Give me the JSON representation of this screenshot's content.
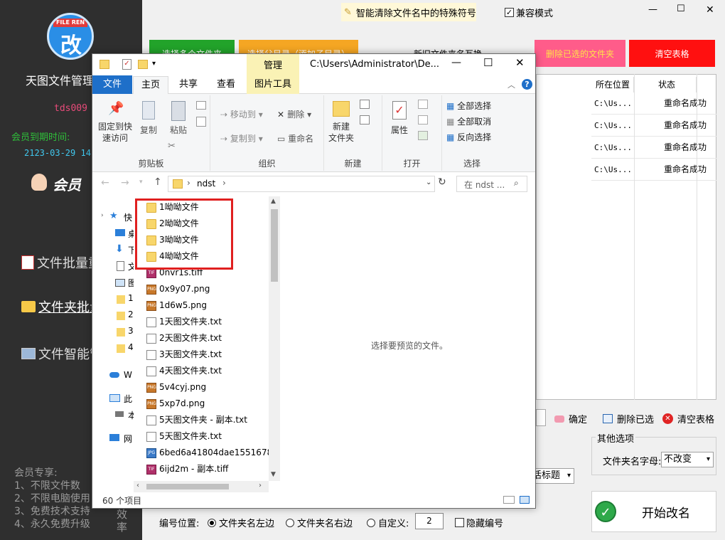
{
  "app": {
    "logo_text": "FILE REN",
    "logo_glyph": "改",
    "title": "天图文件管理",
    "user": "tds009",
    "expiry_label": "会员到期时间:",
    "expiry_date": "2123-03-29 14:",
    "vip_label": "会员",
    "menu": [
      {
        "label": "文件批量重"
      },
      {
        "label": "文件夹批量"
      },
      {
        "label": "文件智能管"
      }
    ],
    "vip_perks_title": "会员专享:",
    "vip_perks": [
      "1、不限文件数",
      "2、不限电脑使用",
      "3、免费技术支持",
      "4、永久免费升级"
    ],
    "efficiency": "效率"
  },
  "topbar": {
    "special_chars_label": "智能清除文件名中的特殊符号",
    "compat_label": "兼容模式",
    "compat_checked": true,
    "window_controls": [
      "—",
      "☐",
      "✕"
    ]
  },
  "buttons": {
    "select_folders": "选择多个文件夹",
    "select_parent": "选择父目录（添加子目录）",
    "swap": "新旧文件夹名互换",
    "delete_selected_folders": "删除已选的文件夹",
    "clear_table": "清空表格",
    "confirm": "确定",
    "delete_selected": "删除已选",
    "clear_table2": "清空表格",
    "start_rename": "开始改名"
  },
  "table": {
    "headers": [
      "所在位置",
      "状态"
    ],
    "rows": [
      {
        "location": "C:\\Us...",
        "status": "重命名成功"
      },
      {
        "location": "C:\\Us...",
        "status": "重命名成功"
      },
      {
        "location": "C:\\Us...",
        "status": "重命名成功"
      },
      {
        "location": "C:\\Us...",
        "status": "重命名成功"
      }
    ]
  },
  "other_options": {
    "title": "其他选项",
    "case_label": "文件夹名字母:",
    "case_value": "不改变",
    "partial_label": "活标题"
  },
  "numbering": {
    "label": "编号位置:",
    "opt_left": "文件夹名左边",
    "opt_right": "文件夹名右边",
    "opt_custom": "自定义:",
    "custom_value": "2",
    "hide_label": "隐藏编号",
    "selected": "left"
  },
  "explorer": {
    "qat_title": "",
    "manage_tab": "管理",
    "path_title": "C:\\Users\\Administrator\\De...",
    "tabs": [
      "文件",
      "主页",
      "共享",
      "查看",
      "图片工具"
    ],
    "active_tab": "主页",
    "ribbon": {
      "pin": "固定到快\n速访问",
      "copy": "复制",
      "paste": "粘贴",
      "clipboard": "剪贴板",
      "move_to": "移动到",
      "copy_to": "复制到",
      "delete": "删除",
      "rename": "重命名",
      "organize": "组织",
      "new_folder": "新建\n文件夹",
      "new": "新建",
      "properties": "属性",
      "open": "打开",
      "select_all": "全部选择",
      "select_none": "全部取消",
      "invert": "反向选择",
      "select": "选择"
    },
    "address": "ndst",
    "search_placeholder": "在 ndst ...",
    "nav_items": [
      "快",
      "桌",
      "下",
      "文",
      "图",
      "1",
      "2",
      "3",
      "4",
      "W",
      "此",
      "本",
      "网"
    ],
    "files": [
      {
        "name": "1呦呦文件",
        "type": "folder"
      },
      {
        "name": "2呦呦文件",
        "type": "folder"
      },
      {
        "name": "3呦呦文件",
        "type": "folder"
      },
      {
        "name": "4呦呦文件",
        "type": "folder"
      },
      {
        "name": "0nvr1s.tiff",
        "type": "tif"
      },
      {
        "name": "0x9y07.png",
        "type": "png"
      },
      {
        "name": "1d6w5.png",
        "type": "png"
      },
      {
        "name": "1天图文件夹.txt",
        "type": "txt"
      },
      {
        "name": "2天图文件夹.txt",
        "type": "txt"
      },
      {
        "name": "3天图文件夹.txt",
        "type": "txt"
      },
      {
        "name": "4天图文件夹.txt",
        "type": "txt"
      },
      {
        "name": "5v4cyj.png",
        "type": "png"
      },
      {
        "name": "5xp7d.png",
        "type": "png"
      },
      {
        "name": "5天图文件夹 - 副本.txt",
        "type": "txt"
      },
      {
        "name": "5天图文件夹.txt",
        "type": "txt"
      },
      {
        "name": "6bed6a41804dae1551678",
        "type": "jpg"
      },
      {
        "name": "6ijd2m - 副本.tiff",
        "type": "tif"
      }
    ],
    "preview_hint": "选择要预览的文件。",
    "status_count": "60 个项目"
  },
  "colors": {
    "green": "#22a32a",
    "orange": "#f5a623",
    "pink": "#ff5c8a",
    "red": "#ff1010",
    "sidebar": "#2f2f2f",
    "highlight_box": "#e02020"
  }
}
